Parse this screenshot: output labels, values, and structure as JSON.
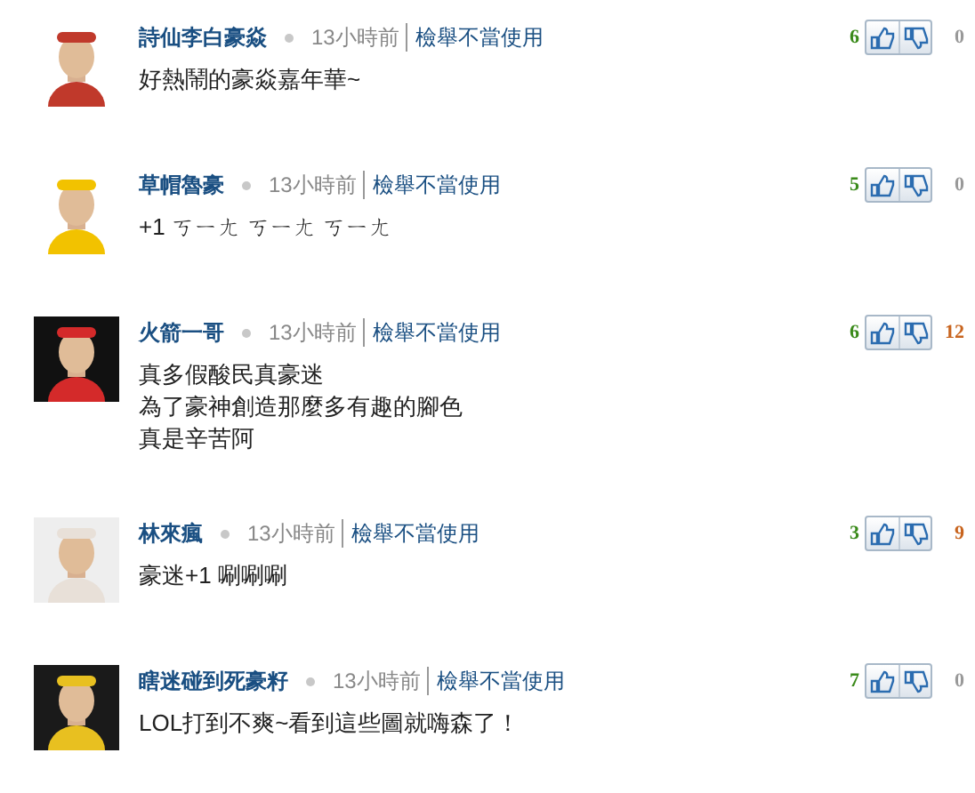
{
  "comments": [
    {
      "author": "詩仙李白豪焱",
      "time": "13小時前",
      "report": "檢舉不當使用",
      "likes": "6",
      "dislikes": {
        "count": "0",
        "color": "#999999"
      },
      "lines": [
        "好熱鬧的豪焱嘉年華~"
      ]
    },
    {
      "author": "草帽魯豪",
      "time": "13小時前",
      "report": "檢舉不當使用",
      "likes": "5",
      "dislikes": {
        "count": "0",
        "color": "#999999"
      },
      "lines": [
        "+1 ㄎㄧㄤ ㄎㄧㄤ ㄎㄧㄤ"
      ]
    },
    {
      "author": "火箭一哥",
      "time": "13小時前",
      "report": "檢舉不當使用",
      "likes": "6",
      "dislikes": {
        "count": "12",
        "color": "#c8641e"
      },
      "lines": [
        "真多假酸民真豪迷",
        "為了豪神創造那麼多有趣的腳色",
        "真是辛苦阿"
      ]
    },
    {
      "author": "林來瘋",
      "time": "13小時前",
      "report": "檢舉不當使用",
      "likes": "3",
      "dislikes": {
        "count": "9",
        "color": "#c8641e"
      },
      "lines": [
        "豪迷+1 唰唰唰"
      ]
    },
    {
      "author": "瞎迷碰到死豪籽",
      "time": "13小時前",
      "report": "檢舉不當使用",
      "likes": "7",
      "dislikes": {
        "count": "0",
        "color": "#999999"
      },
      "lines": [
        "LOL打到不爽~看到這些圖就嗨森了！"
      ]
    }
  ]
}
